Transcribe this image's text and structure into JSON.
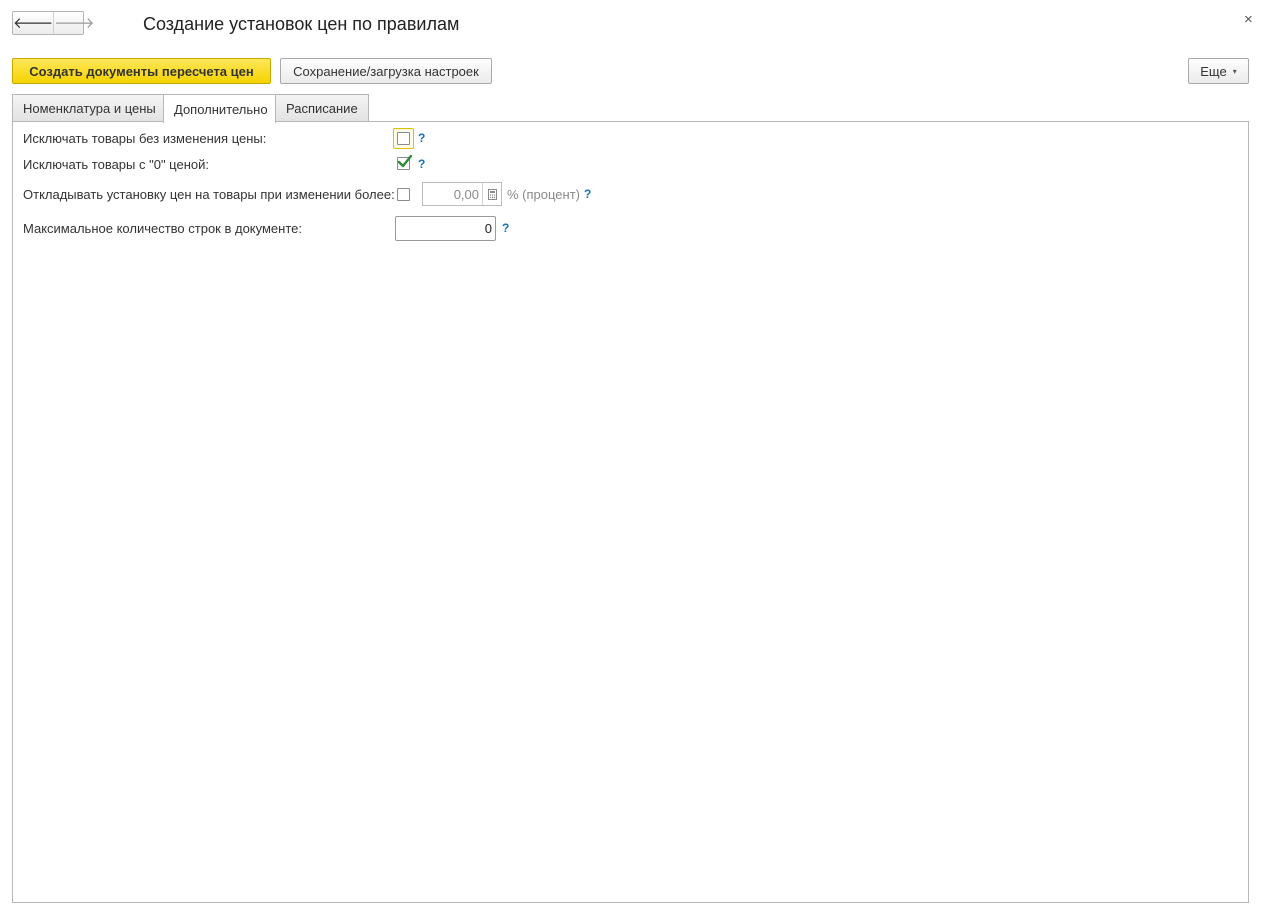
{
  "window": {
    "title": "Создание установок цен по правилам",
    "nav_back": "🡐",
    "nav_forward": "🡒",
    "close": "×"
  },
  "toolbar": {
    "create_docs_label": "Создать документы пересчета цен",
    "settings_label": "Сохранение/загрузка настроек",
    "more_label": "Еще",
    "more_caret": "▾"
  },
  "tabs": [
    {
      "label": "Номенклатура и цены",
      "active": false
    },
    {
      "label": "Дополнительно",
      "active": true
    },
    {
      "label": "Расписание",
      "active": false
    }
  ],
  "form": {
    "exclude_unchanged": {
      "label": "Исключать товары без изменения цены:",
      "checked": false,
      "help": "?"
    },
    "exclude_zero": {
      "label": "Исключать товары с \"0\" ценой:",
      "checked": true,
      "help": "?"
    },
    "defer_price": {
      "label": "Откладывать установку цен на товары при изменении более:",
      "checked": false,
      "value": "0,00",
      "unit": "% (процент)",
      "help": "?"
    },
    "max_rows": {
      "label": "Максимальное количество строк в документе:",
      "value": "0",
      "help": "?"
    }
  },
  "colors": {
    "primary_button": "#f5d300",
    "help_link": "#1a6fb8",
    "check_mark": "#2f8a3b",
    "focus_border": "#e0c000"
  },
  "icons": {
    "back": "arrow-left-icon",
    "forward": "arrow-right-icon",
    "close": "close-icon",
    "calculator": "calculator-icon",
    "check": "checkmark-icon"
  }
}
